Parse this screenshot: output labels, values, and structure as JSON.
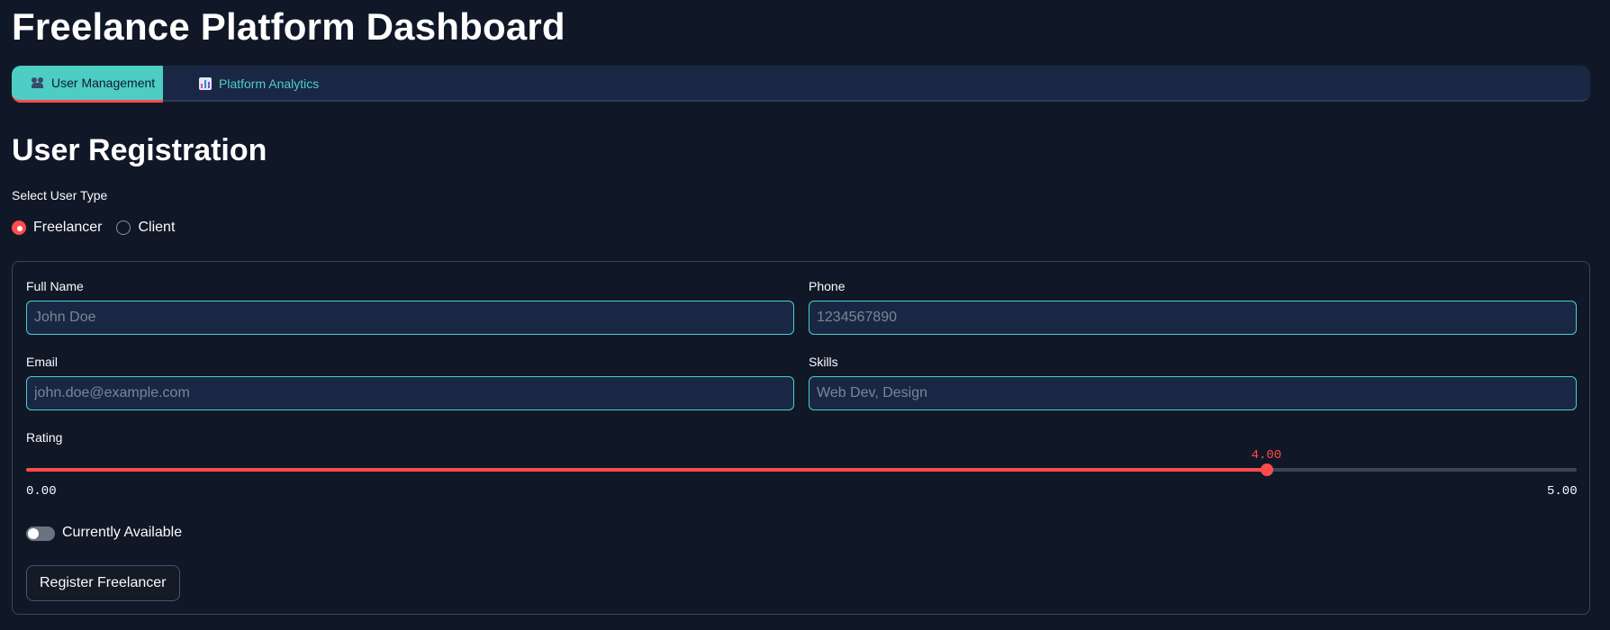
{
  "page": {
    "title": "Freelance Platform Dashboard"
  },
  "tabs": [
    {
      "label": "User Management",
      "icon": "people-icon",
      "active": true
    },
    {
      "label": "Platform Analytics",
      "icon": "bar-chart-icon",
      "active": false
    }
  ],
  "registration": {
    "heading": "User Registration",
    "user_type": {
      "label": "Select User Type",
      "options": [
        "Freelancer",
        "Client"
      ],
      "selected": "Freelancer"
    },
    "form": {
      "full_name": {
        "label": "Full Name",
        "placeholder": "John Doe",
        "value": ""
      },
      "phone": {
        "label": "Phone",
        "placeholder": "1234567890",
        "value": ""
      },
      "email": {
        "label": "Email",
        "placeholder": "john.doe@example.com",
        "value": ""
      },
      "skills": {
        "label": "Skills",
        "placeholder": "Web Dev, Design",
        "value": ""
      },
      "rating": {
        "label": "Rating",
        "value": 4.0,
        "value_text": "4.00",
        "min": 0,
        "max": 5,
        "min_text": "0.00",
        "max_text": "5.00"
      },
      "availability": {
        "label": "Currently Available",
        "checked": false
      },
      "submit_label": "Register Freelancer"
    }
  },
  "colors": {
    "background": "#101828",
    "accent": "#4ecdc4",
    "primary": "#ff4b4b",
    "input_bg": "#1a2744"
  }
}
